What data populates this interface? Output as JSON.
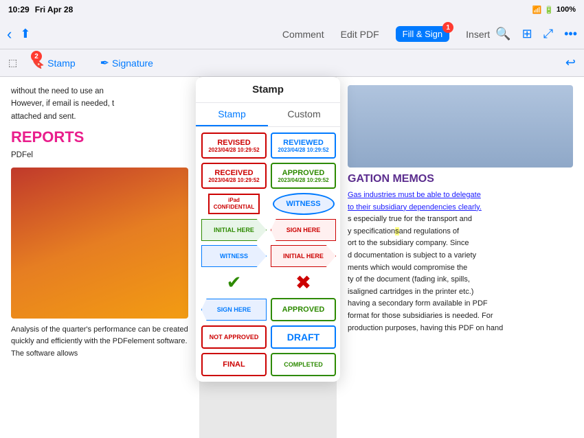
{
  "statusBar": {
    "time": "10:29",
    "day": "Fri Apr 28",
    "wifi": "WiFi",
    "battery": "100%"
  },
  "toolbar": {
    "comment": "Comment",
    "editPdf": "Edit PDF",
    "fillSign": "Fill & Sign",
    "insert": "Insert",
    "fillSignBadge": "1"
  },
  "secondaryToolbar": {
    "stampBadge": "2",
    "stampLabel": "Stamp",
    "signatureLabel": "Signature"
  },
  "stampPanel": {
    "title": "Stamp",
    "tab1": "Stamp",
    "tab2": "Custom",
    "items": {
      "revised": "REVISED",
      "revisedDate": "2023/04/28 10:29:52",
      "reviewed": "REVIEWED",
      "reviewedDate": "2023/04/28 10:29:52",
      "received": "RECEIVED",
      "receivedDate": "2023/04/28 10:29:52",
      "approved": "APPROVED",
      "approvedDate": "2023/04/28 10:29:52",
      "confidentialTop": "iPad",
      "confidential": "CONFIDENTIAL",
      "witness": "WITNESS",
      "initialHere": "INITIAL HERE",
      "signHere": "SIGN HERE",
      "witnessArrow": "WITNESS",
      "initialHereArrow": "INITIAL HERE",
      "notApproved": "NOT APPROVED",
      "draft": "DRAFT",
      "final": "FINAL",
      "completed": "COMPLETED",
      "approvedGreen": "APPROVED"
    }
  },
  "pdfLeft": {
    "text1": "without the need to use an",
    "text2": "However, if email is needed,",
    "text3": "attached and sent.",
    "heading": "REPORTS",
    "subtext": "PDFel",
    "analysisText": "Analysis of the quarter's performance can be created quickly and efficiently with the PDFelement software. The software allows"
  },
  "pdfRight": {
    "heading": "GATION MEMOS",
    "text": "Gas industries must be able to delegate to their subsidiary dependencies clearly. s especially true for the transport and y specifications and regulations of ort to the subsidiary company. Since d documentation is subject to a variety ments which would compromise the ty of the document (fading ink, spills, isaligned cartridges in the printer etc.) having a secondary form available in PDF format for those subsidiaries is needed. For production purposes, having this PDF on hand"
  }
}
